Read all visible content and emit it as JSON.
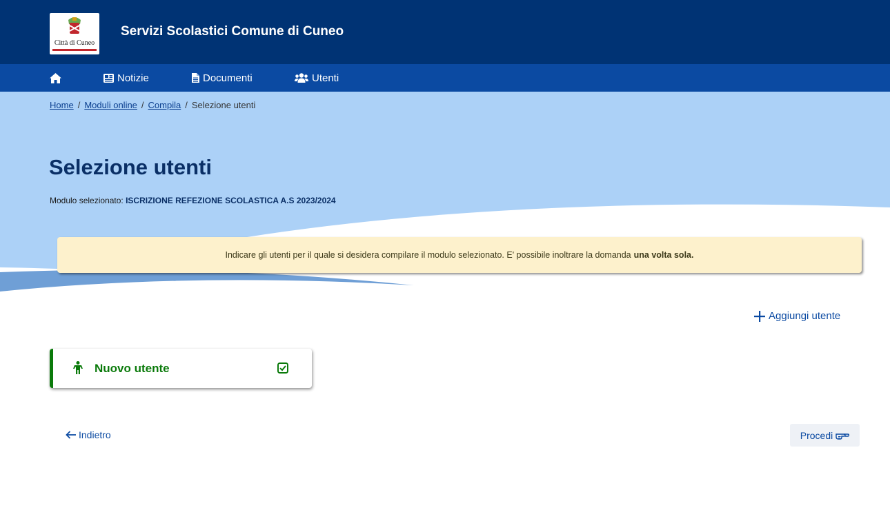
{
  "header": {
    "logo_text": "Città di Cuneo",
    "title": "Servizi Scolastici Comune di Cuneo"
  },
  "nav": {
    "items": [
      {
        "label": "",
        "icon": "home-icon"
      },
      {
        "label": "Notizie",
        "icon": "newspaper-icon"
      },
      {
        "label": "Documenti",
        "icon": "document-icon"
      },
      {
        "label": "Utenti",
        "icon": "users-icon"
      }
    ]
  },
  "breadcrumb": {
    "items": [
      "Home",
      "Moduli online",
      "Compila",
      "Selezione utenti"
    ],
    "separator": "/"
  },
  "page": {
    "title": "Selezione utenti",
    "module_label": "Modulo selezionato:",
    "module_value": "ISCRIZIONE REFEZIONE SCOLASTICA A.S 2023/2024"
  },
  "alert": {
    "text": "Indicare gli utenti per il quale si desidera compilare il modulo selezionato.  E' possibile inoltrare la domanda",
    "emphasis": "una volta sola."
  },
  "actions": {
    "add_user": "Aggiungi utente",
    "back": "Indietro",
    "proceed": "Procedi"
  },
  "users": [
    {
      "name": "Nuovo utente",
      "selected": true,
      "icon": "person-icon"
    }
  ],
  "colors": {
    "header_bg": "#003374",
    "nav_bg": "#0b4aa2",
    "hero_bg": "#acd1f7",
    "title": "#0a2f66",
    "alert_bg": "#fdf1cc",
    "user_green": "#0a7a0a",
    "link_blue": "#0b4aa2"
  }
}
